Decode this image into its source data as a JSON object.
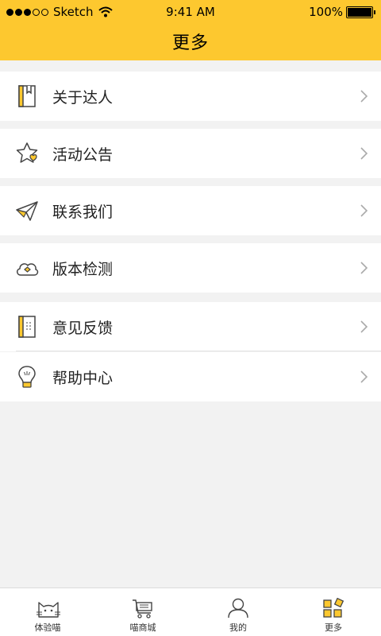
{
  "status": {
    "carrier": "Sketch",
    "time": "9:41 AM",
    "battery": "100%"
  },
  "header": {
    "title": "更多"
  },
  "menu": {
    "items": [
      {
        "label": "关于达人",
        "icon": "book-icon"
      },
      {
        "label": "活动公告",
        "icon": "star-heart-icon"
      },
      {
        "label": "联系我们",
        "icon": "paper-plane-icon"
      },
      {
        "label": "版本检测",
        "icon": "cloud-refresh-icon"
      },
      {
        "label": "意见反馈",
        "icon": "notebook-icon"
      },
      {
        "label": "帮助中心",
        "icon": "lightbulb-icon"
      }
    ]
  },
  "tabs": [
    {
      "label": "体验喵",
      "icon": "cat-icon",
      "active": false
    },
    {
      "label": "喵商城",
      "icon": "cart-icon",
      "active": false
    },
    {
      "label": "我的",
      "icon": "person-icon",
      "active": false
    },
    {
      "label": "更多",
      "icon": "grid-icon",
      "active": true
    }
  ],
  "colors": {
    "accent": "#fdc82f",
    "background": "#f2f2f2",
    "icon_stroke": "#444444"
  }
}
